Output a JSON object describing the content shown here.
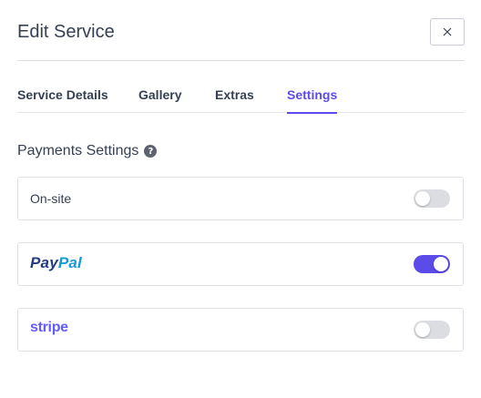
{
  "dialog": {
    "title": "Edit Service",
    "close_symbol": "×"
  },
  "tabs": [
    {
      "label": "Service Details",
      "active": false
    },
    {
      "label": "Gallery",
      "active": false
    },
    {
      "label": "Extras",
      "active": false
    },
    {
      "label": "Settings",
      "active": true
    }
  ],
  "payments": {
    "section_title": "Payments Settings",
    "help_symbol": "?",
    "methods": [
      {
        "label": "On-site",
        "enabled": false
      },
      {
        "label": "PayPal",
        "logo_part1": "Pay",
        "logo_part2": "Pal",
        "enabled": true
      },
      {
        "label": "stripe",
        "enabled": false
      }
    ]
  },
  "colors": {
    "accent": "#5b4be8",
    "text": "#354052",
    "paypal_dark": "#253b80",
    "paypal_light": "#179bd7",
    "stripe": "#635bff"
  }
}
